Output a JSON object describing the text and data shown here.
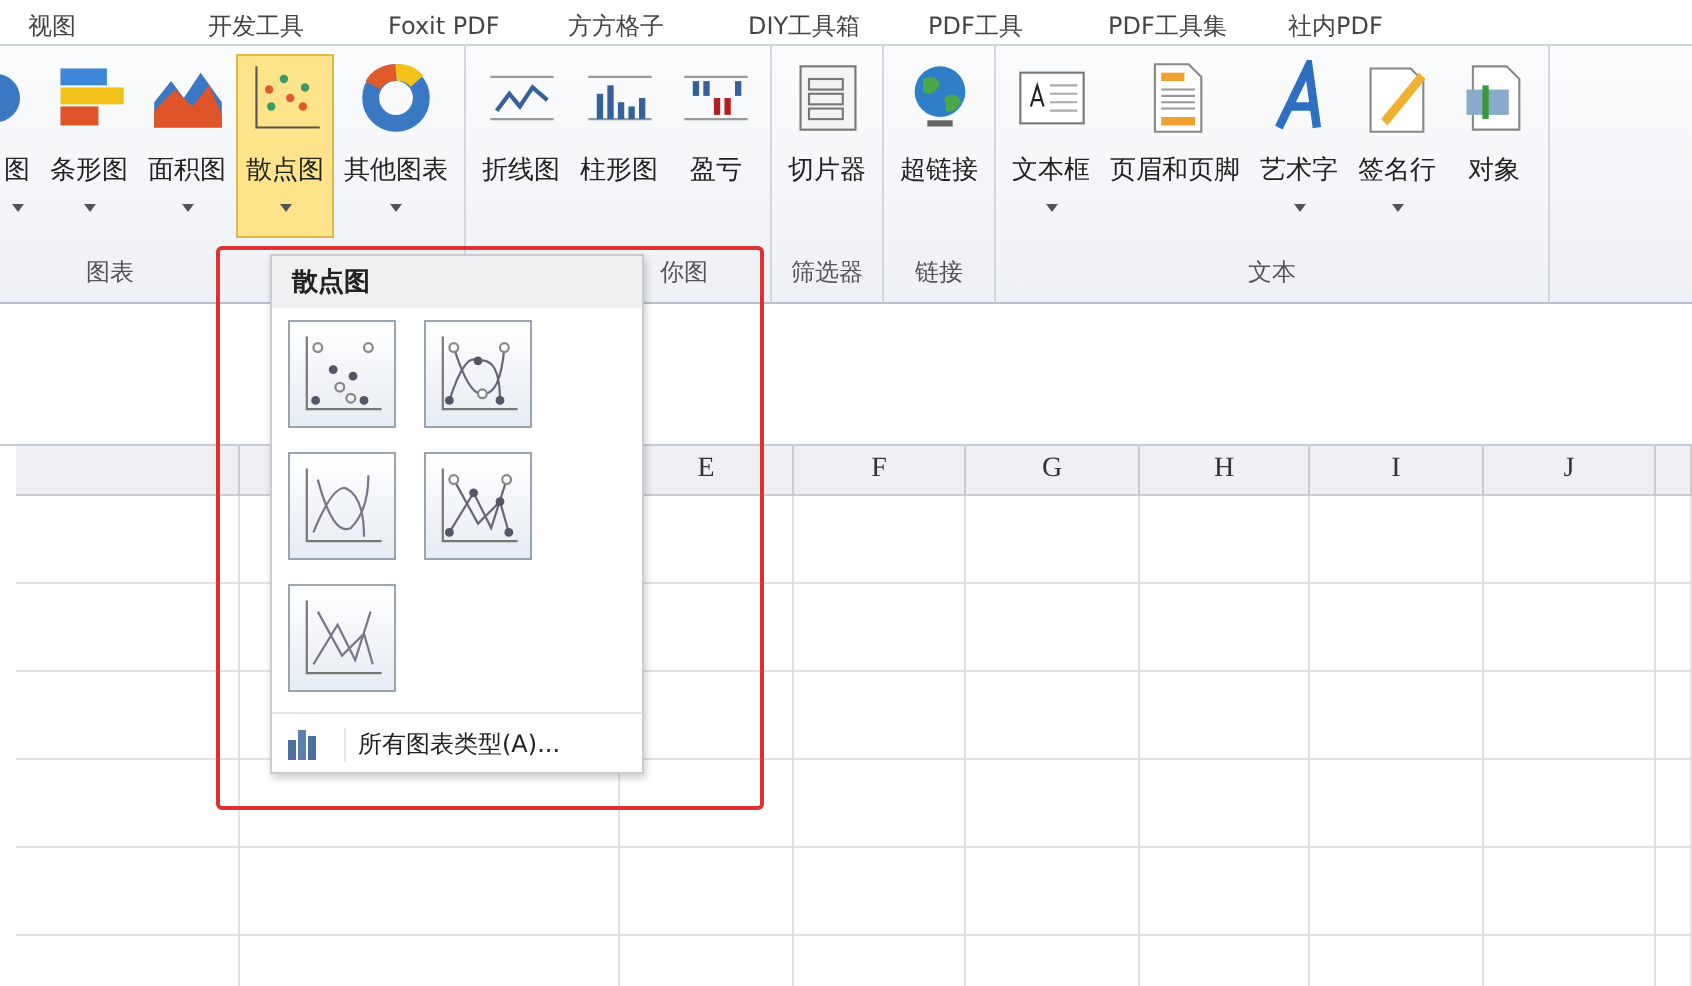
{
  "tabs": [
    {
      "label": "视图",
      "selected": false
    },
    {
      "label": "开发工具",
      "selected": false
    },
    {
      "label": "Foxit PDF",
      "selected": false
    },
    {
      "label": "方方格子",
      "selected": false
    },
    {
      "label": "DIY工具箱",
      "selected": false
    },
    {
      "label": "PDF工具",
      "selected": false
    },
    {
      "label": "PDF工具集",
      "selected": false
    },
    {
      "label": "社内PDF",
      "selected": false
    }
  ],
  "ribbon_groups": [
    {
      "label": "图表",
      "buttons": [
        {
          "label": "图",
          "dropdown": true,
          "selected": false
        },
        {
          "label": "条形图",
          "dropdown": true,
          "selected": false
        },
        {
          "label": "面积图",
          "dropdown": true,
          "selected": false
        },
        {
          "label": "散点图",
          "dropdown": true,
          "selected": true
        },
        {
          "label": "其他图表",
          "dropdown": true,
          "selected": false
        }
      ]
    },
    {
      "label": "你图",
      "buttons": [
        {
          "label": "折线图",
          "dropdown": false,
          "selected": false
        },
        {
          "label": "柱形图",
          "dropdown": false,
          "selected": false
        },
        {
          "label": "盈亏",
          "dropdown": false,
          "selected": false
        }
      ]
    },
    {
      "label": "筛选器",
      "buttons": [
        {
          "label": "切片器",
          "dropdown": false,
          "selected": false
        }
      ]
    },
    {
      "label": "链接",
      "buttons": [
        {
          "label": "超链接",
          "dropdown": false,
          "selected": false
        }
      ]
    },
    {
      "label": "文本",
      "buttons": [
        {
          "label": "文本框",
          "dropdown": true,
          "selected": false
        },
        {
          "label": "页眉和页脚",
          "dropdown": false,
          "selected": false
        },
        {
          "label": "艺术字",
          "dropdown": true,
          "selected": false
        },
        {
          "label": "签名行",
          "dropdown": true,
          "selected": false
        },
        {
          "label": "对象",
          "dropdown": false,
          "selected": false
        }
      ]
    }
  ],
  "dropdown_menu": {
    "title": "散点图",
    "options": [
      {
        "kind": "markers"
      },
      {
        "kind": "smooth-markers"
      },
      {
        "kind": "smooth"
      },
      {
        "kind": "straight-markers"
      },
      {
        "kind": "straight"
      }
    ],
    "footer": "所有图表类型(A)..."
  },
  "sheet": {
    "columns": [
      "",
      "",
      "E",
      "F",
      "G",
      "H",
      "I",
      "J",
      ""
    ]
  }
}
